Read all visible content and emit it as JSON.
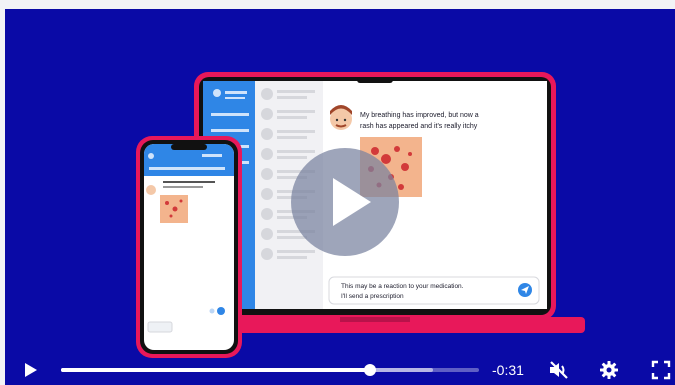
{
  "video": {
    "chat_message_patient": [
      "My breathing has improved, but now a",
      "rash has appeared and it's really itchy"
    ],
    "chat_message_doctor": [
      "This may be a reaction to your medication.",
      "I'll send a prescription"
    ]
  },
  "controls": {
    "time_remaining": "-0:31",
    "progress_fraction": 0.74,
    "buffered_fraction": 0.89
  },
  "icons": {
    "play": "play-icon",
    "big_play": "play-icon",
    "mute": "volume-muted-icon",
    "settings": "gear-icon",
    "fullscreen": "fullscreen-icon"
  },
  "colors": {
    "background": "#0a0aa6",
    "accent": "#e8185a",
    "laptop_sidebar": "#2f86e6"
  }
}
